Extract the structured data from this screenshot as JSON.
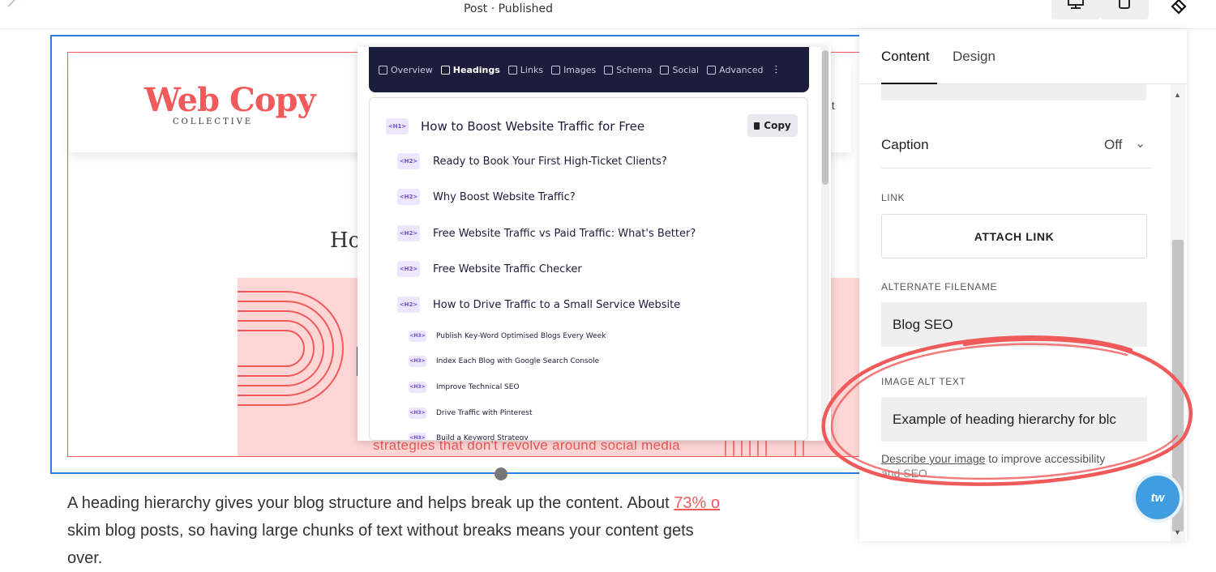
{
  "topbar": {
    "status": "Post · Published",
    "undo_icon": "redo-icon",
    "desktop_icon": "desktop-icon",
    "mobile_icon": "mobile-icon",
    "style_icon": "diamond-icon"
  },
  "page": {
    "logo_main": "Web Copy",
    "logo_sub": "COLLECTIVE",
    "nav_fragment": "ut",
    "heading_fragment": "Ho",
    "banner_text": "strategies that don't revolve around social media",
    "body_line1": "A heading hierarchy gives your blog structure and helps break up the content. About ",
    "body_link": "73% o",
    "body_line2": "skim blog posts, so having large chunks of text without breaks means your content gets",
    "body_line3": "over."
  },
  "seo_panel": {
    "tabs": [
      {
        "label": "Overview",
        "active": false
      },
      {
        "label": "Headings",
        "active": true
      },
      {
        "label": "Links",
        "active": false
      },
      {
        "label": "Images",
        "active": false
      },
      {
        "label": "Schema",
        "active": false
      },
      {
        "label": "Social",
        "active": false
      },
      {
        "label": "Advanced",
        "active": false
      }
    ],
    "copy_label": "Copy",
    "h1": {
      "tag": "<H1>",
      "text": "How to Boost Website Traffic for Free"
    },
    "h2": [
      {
        "tag": "<H2>",
        "text": "Ready to Book Your First High-Ticket Clients?"
      },
      {
        "tag": "<H2>",
        "text": "Why Boost Website Traffic?"
      },
      {
        "tag": "<H2>",
        "text": "Free Website Traffic vs Paid Traffic: What's Better?"
      },
      {
        "tag": "<H2>",
        "text": "Free Website Traffic Checker"
      },
      {
        "tag": "<H2>",
        "text": "How to Drive Traffic to a Small Service Website"
      }
    ],
    "h3": [
      {
        "tag": "<H3>",
        "text": "Publish Key-Word Optimised Blogs Every Week"
      },
      {
        "tag": "<H3>",
        "text": "Index Each Blog with Google Search Console"
      },
      {
        "tag": "<H3>",
        "text": "Improve Technical SEO"
      },
      {
        "tag": "<H3>",
        "text": "Drive Traffic with Pinterest"
      },
      {
        "tag": "<H3>",
        "text": "Build a Keyword Strategy"
      }
    ]
  },
  "sidebar": {
    "tab_content": "Content",
    "tab_design": "Design",
    "caption_label": "Caption",
    "caption_value": "Off",
    "link_label": "LINK",
    "attach_link": "ATTACH LINK",
    "alt_filename_label": "ALTERNATE FILENAME",
    "alt_filename_value": "Blog SEO",
    "alt_text_label": "IMAGE ALT TEXT",
    "alt_text_value": "Example of heading hierarchy for blc",
    "hint_link": "Describe your image",
    "hint_rest": " to improve accessibility",
    "hint_line2": "and SEO.",
    "badge": "tw"
  },
  "colors": {
    "accent_red": "#f05a5a",
    "selection_blue": "#2f7de1",
    "seo_dark": "#1c1c3c",
    "badge_blue": "#3f9de0"
  }
}
